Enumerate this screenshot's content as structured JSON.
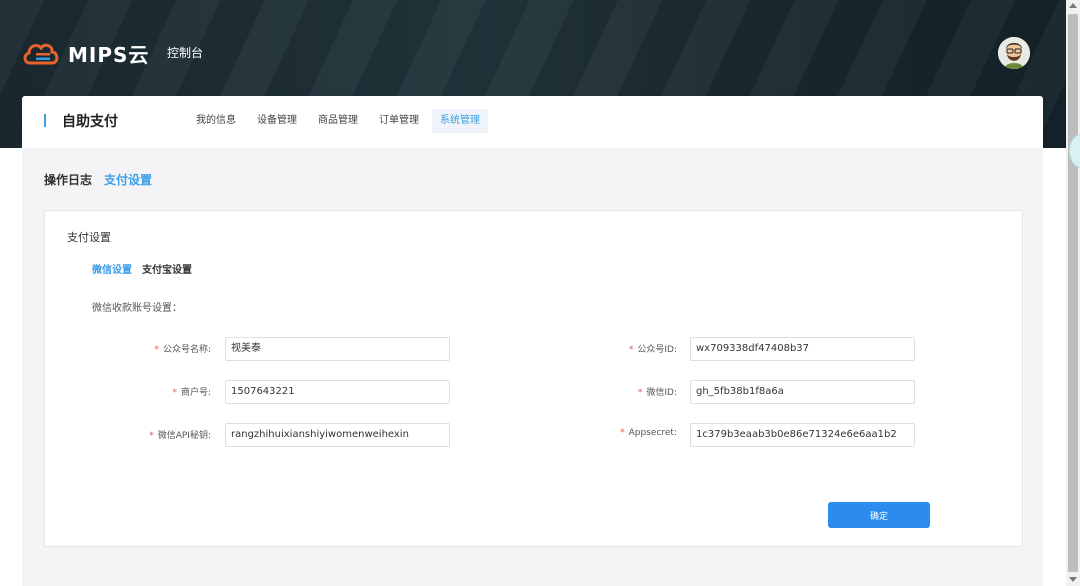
{
  "app": {
    "logo_text": "MIPS云",
    "console_label": "控制台"
  },
  "colors": {
    "accent": "#3a9ee6",
    "button": "#2c8bee",
    "required": "#e5534b"
  },
  "header": {
    "title": "自助支付",
    "nav": [
      {
        "label": "我的信息",
        "active": false
      },
      {
        "label": "设备管理",
        "active": false
      },
      {
        "label": "商品管理",
        "active": false
      },
      {
        "label": "订单管理",
        "active": false
      },
      {
        "label": "系统管理",
        "active": true
      }
    ]
  },
  "subtabs": [
    {
      "label": "操作日志",
      "active": false
    },
    {
      "label": "支付设置",
      "active": true
    }
  ],
  "panel": {
    "title": "支付设置",
    "pay_tabs": [
      {
        "label": "微信设置",
        "active": true
      },
      {
        "label": "支付宝设置",
        "active": false
      }
    ],
    "section_label": "微信收款账号设置：",
    "fields": {
      "account_name": {
        "label": "公众号名称:",
        "value": "视美泰"
      },
      "account_id": {
        "label": "公众号ID:",
        "value": "wx709338df47408b37"
      },
      "merchant_no": {
        "label": "商户号:",
        "value": "1507643221"
      },
      "wechat_id": {
        "label": "微信ID:",
        "value": "gh_5fb38b1f8a6a"
      },
      "api_key": {
        "label": "微信API秘钥:",
        "value": "rangzhihuixianshiyiwomenweihexin"
      },
      "appsecret": {
        "label": "Appsecret:",
        "value": "1c379b3eaab3b0e86e71324e6e6aa1b2"
      }
    },
    "required_mark": "*",
    "confirm_label": "确定"
  }
}
